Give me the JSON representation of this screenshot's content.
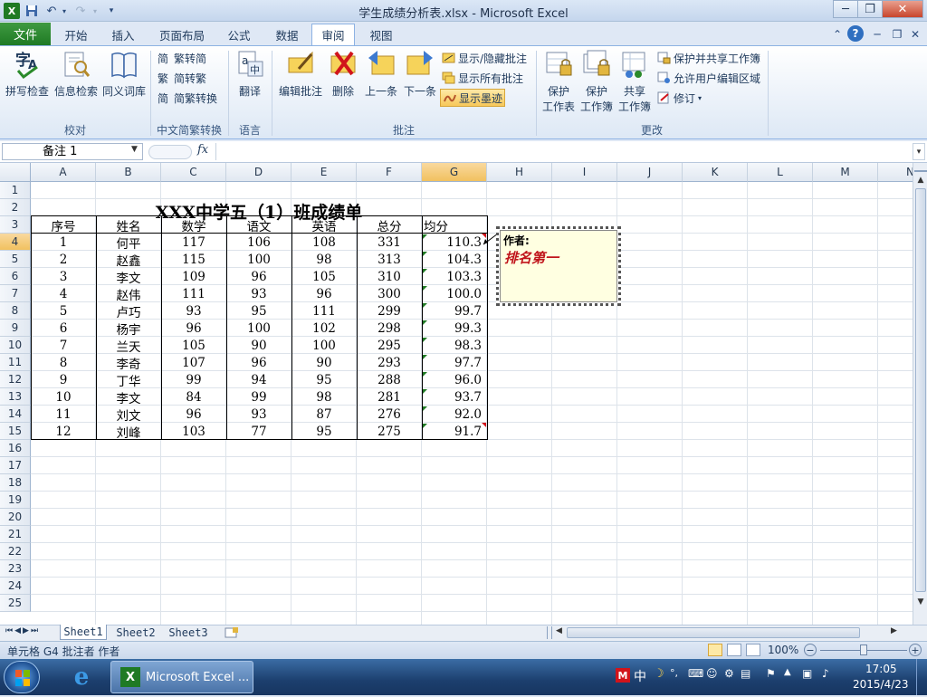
{
  "window": {
    "title": "学生成绩分析表.xlsx - Microsoft Excel"
  },
  "tabs": {
    "file": "文件",
    "items": [
      "开始",
      "插入",
      "页面布局",
      "公式",
      "数据",
      "审阅",
      "视图"
    ],
    "active": "审阅"
  },
  "ribbon": {
    "proofing": {
      "spell": "拼写检查",
      "research": "信息检索",
      "thesaurus": "同义词库",
      "label": "校对"
    },
    "chinese_conversion": {
      "to_simplified": "繁转简",
      "to_traditional": "简转繁",
      "convert": "简繁转换",
      "label": "中文简繁转换"
    },
    "language": {
      "translate": "翻译",
      "label": "语言"
    },
    "comments": {
      "edit": "编辑批注",
      "delete": "删除",
      "previous": "上一条",
      "next": "下一条",
      "show_hide": "显示/隐藏批注",
      "show_all": "显示所有批注",
      "show_ink": "显示墨迹",
      "label": "批注"
    },
    "changes": {
      "protect_sheet_1": "保护",
      "protect_sheet_2": "工作表",
      "protect_book_1": "保护",
      "protect_book_2": "工作簿",
      "share_book_1": "共享",
      "share_book_2": "工作簿",
      "protect_share": "保护并共享工作簿",
      "allow_edit": "允许用户编辑区域",
      "track": "修订",
      "label": "更改"
    }
  },
  "formula_bar": {
    "name_box": "备注 1",
    "fx": "fx",
    "formula": ""
  },
  "columns": [
    "A",
    "B",
    "C",
    "D",
    "E",
    "F",
    "G",
    "H",
    "I",
    "J",
    "K",
    "L",
    "M",
    "N"
  ],
  "rows": [
    "1",
    "2",
    "3",
    "4",
    "5",
    "6",
    "7",
    "8",
    "9",
    "10",
    "11",
    "12",
    "13",
    "14",
    "15",
    "16",
    "17",
    "18",
    "19",
    "20",
    "21",
    "22",
    "23",
    "24",
    "25"
  ],
  "sheet": {
    "title": "XXX中学五（1）班成绩单",
    "headers": [
      "序号",
      "姓名",
      "数学",
      "语文",
      "英语",
      "总分",
      "均分"
    ],
    "data": [
      [
        "1",
        "何平",
        "117",
        "106",
        "108",
        "331",
        "110.3"
      ],
      [
        "2",
        "赵鑫",
        "115",
        "100",
        "98",
        "313",
        "104.3"
      ],
      [
        "3",
        "李文",
        "109",
        "96",
        "105",
        "310",
        "103.3"
      ],
      [
        "4",
        "赵伟",
        "111",
        "93",
        "96",
        "300",
        "100.0"
      ],
      [
        "5",
        "卢巧",
        "93",
        "95",
        "111",
        "299",
        "99.7"
      ],
      [
        "6",
        "杨宇",
        "96",
        "100",
        "102",
        "298",
        "99.3"
      ],
      [
        "7",
        "兰天",
        "105",
        "90",
        "100",
        "295",
        "98.3"
      ],
      [
        "8",
        "李奇",
        "107",
        "96",
        "90",
        "293",
        "97.7"
      ],
      [
        "9",
        "丁华",
        "99",
        "94",
        "95",
        "288",
        "96.0"
      ],
      [
        "10",
        "李文",
        "84",
        "99",
        "98",
        "281",
        "93.7"
      ],
      [
        "11",
        "刘文",
        "96",
        "93",
        "87",
        "276",
        "92.0"
      ],
      [
        "12",
        "刘峰",
        "103",
        "77",
        "95",
        "275",
        "91.7"
      ]
    ]
  },
  "comment": {
    "author": "作者:",
    "text": "排名第一"
  },
  "sheet_tabs": [
    "Sheet1",
    "Sheet2",
    "Sheet3"
  ],
  "status": {
    "text": "单元格 G4 批注者 作者",
    "zoom": "100%"
  },
  "taskbar": {
    "app": "Microsoft Excel ...",
    "ime": "中",
    "time": "17:05",
    "date": "2015/4/23"
  },
  "colors": {
    "file_tab": "#1f7a24",
    "comment_bg": "#ffffe1",
    "comment_text": "#c0141b",
    "selected_header": "#f1c15f"
  }
}
